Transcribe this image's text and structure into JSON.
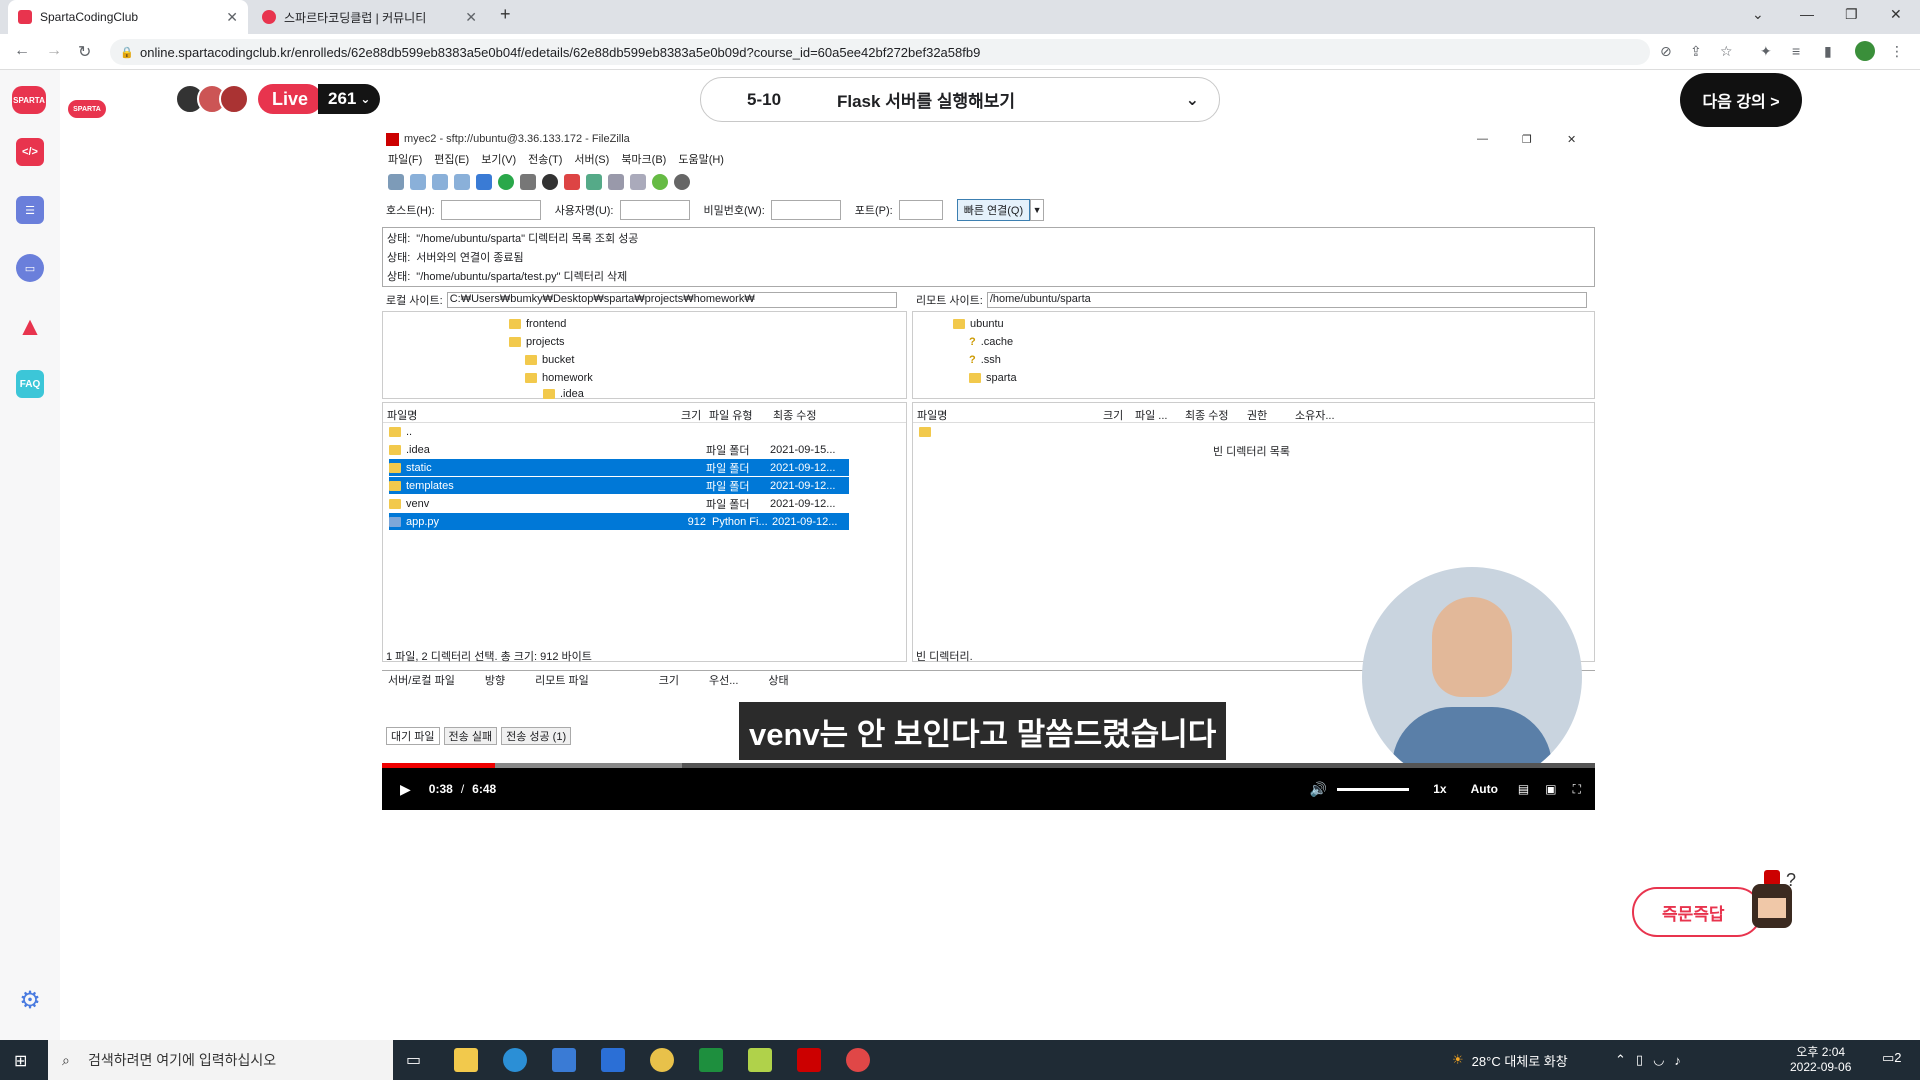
{
  "browser": {
    "tabs": [
      {
        "label": "SpartaCodingClub",
        "active": true
      },
      {
        "label": "스파르타코딩클럽 | 커뮤니티",
        "active": false
      }
    ],
    "url": "online.spartacodingclub.kr/enrolleds/62e88db599eb8383a5e0b04f/edetails/62e88db599eb8383a5e0b09d?course_id=60a5ee42bf272bef32a58fb9"
  },
  "sidebar": {
    "logo_text": "SPARTA",
    "items": [
      {
        "icon": "code-icon"
      },
      {
        "icon": "checklist-icon"
      },
      {
        "icon": "chat-icon"
      },
      {
        "icon": "warning-icon"
      },
      {
        "icon": "faq-icon",
        "label": "FAQ"
      },
      {
        "icon": "settings-icon"
      }
    ]
  },
  "header": {
    "live_label": "Live",
    "live_count": "261",
    "lesson_number": "5-10",
    "lesson_title": "Flask 서버를 실행해보기",
    "next_button": "다음 강의 >"
  },
  "filezilla": {
    "title": "myec2 - sftp://ubuntu@3.36.133.172 - FileZilla",
    "menu": [
      "파일(F)",
      "편집(E)",
      "보기(V)",
      "전송(T)",
      "서버(S)",
      "북마크(B)",
      "도움말(H)"
    ],
    "quickconnect": {
      "host_label": "호스트(H):",
      "user_label": "사용자명(U):",
      "pass_label": "비밀번호(W):",
      "port_label": "포트(P):",
      "connect_button": "빠른 연결(Q)"
    },
    "log": [
      {
        "prefix": "상태:",
        "text": "\"/home/ubuntu/sparta\" 디렉터리 목록 조회 성공"
      },
      {
        "prefix": "상태:",
        "text": "서버와의 연결이 종료됨"
      },
      {
        "prefix": "상태:",
        "text": "\"/home/ubuntu/sparta/test.py\" 디렉터리 삭제"
      }
    ],
    "local": {
      "label": "로컬 사이트:",
      "path": "C:₩Users₩bumky₩Desktop₩sparta₩projects₩homework₩",
      "tree": [
        "frontend",
        "projects",
        "bucket",
        "homework",
        ".idea"
      ],
      "columns": [
        "파일명",
        "크기",
        "파일 유형",
        "최종 수정"
      ],
      "files": [
        {
          "name": "..",
          "size": "",
          "type": "",
          "date": "",
          "selected": false
        },
        {
          "name": ".idea",
          "size": "",
          "type": "파일 폴더",
          "date": "2021-09-15...",
          "selected": false
        },
        {
          "name": "static",
          "size": "",
          "type": "파일 폴더",
          "date": "2021-09-12...",
          "selected": true
        },
        {
          "name": "templates",
          "size": "",
          "type": "파일 폴더",
          "date": "2021-09-12...",
          "selected": true
        },
        {
          "name": "venv",
          "size": "",
          "type": "파일 폴더",
          "date": "2021-09-12...",
          "selected": false
        },
        {
          "name": "app.py",
          "size": "912",
          "type": "Python Fi...",
          "date": "2021-09-12...",
          "selected": true
        }
      ],
      "status": "1 파일, 2 디렉터리 선택. 총 크기: 912 바이트"
    },
    "remote": {
      "label": "리모트 사이트:",
      "path": "/home/ubuntu/sparta",
      "tree": [
        "ubuntu",
        ".cache",
        ".ssh",
        "sparta"
      ],
      "columns": [
        "파일명",
        "크기",
        "파일 ...",
        "최종 수정",
        "권한",
        "소유자..."
      ],
      "empty_text": "빈 디렉터리 목록",
      "status": "빈 디렉터리."
    },
    "queue": {
      "columns": [
        "서버/로컬 파일",
        "방향",
        "리모트 파일",
        "크기",
        "우선...",
        "상태"
      ],
      "tabs": [
        "대기 파일",
        "전송 실패",
        "전송 성공 (1)"
      ]
    }
  },
  "video": {
    "caption": "venv는 안 보인다고 말씀드렸습니다",
    "current_time": "0:38",
    "separator": "/",
    "duration": "6:48",
    "speed": "1x",
    "quality": "Auto",
    "progress_fraction": 0.093
  },
  "quick_answer": "즉문즉답",
  "taskbar": {
    "search_placeholder": "검색하려면 여기에 입력하십시오",
    "weather": "28°C  대체로 화창",
    "time": "오후 2:04",
    "date": "2022-09-06",
    "notifications": "2"
  }
}
